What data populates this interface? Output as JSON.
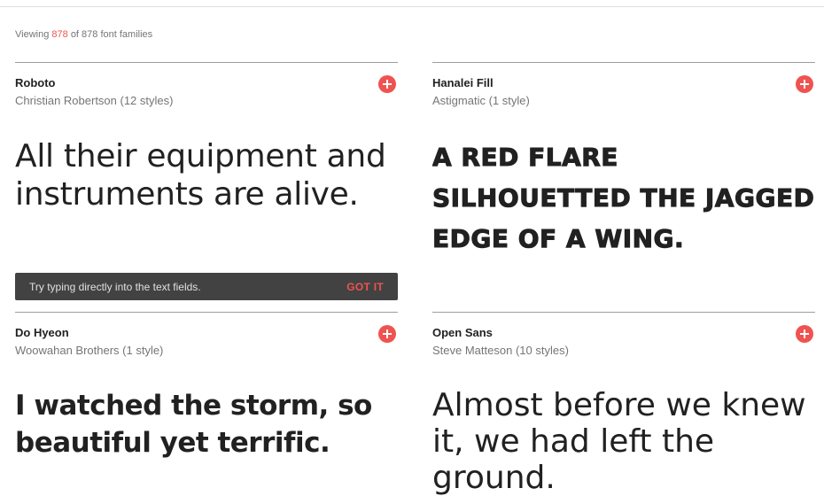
{
  "header": {
    "count_prefix": "Viewing",
    "count_visible": "878",
    "count_suffix": "of 878 font families"
  },
  "cards": [
    {
      "name": "Roboto",
      "designer": "Christian Robertson (12 styles)",
      "sample": "All their equipment and instruments are alive."
    },
    {
      "name": "Hanalei Fill",
      "designer": "Astigmatic (1 style)",
      "sample": "A red flare silhouetted the jagged edge of a wing."
    },
    {
      "name": "Do Hyeon",
      "designer": "Woowahan Brothers (1 style)",
      "sample": "I watched the storm, so beautiful yet terrific."
    },
    {
      "name": "Open Sans",
      "designer": "Steve Matteson (10 styles)",
      "sample": "Almost before we knew it, we had left the ground."
    }
  ],
  "toast": {
    "message": "Try typing directly into the text fields.",
    "action": "GOT IT"
  },
  "colors": {
    "accent": "#ef5350",
    "toast_bg": "#424242"
  },
  "icons": {
    "add": "plus-circle-icon"
  }
}
